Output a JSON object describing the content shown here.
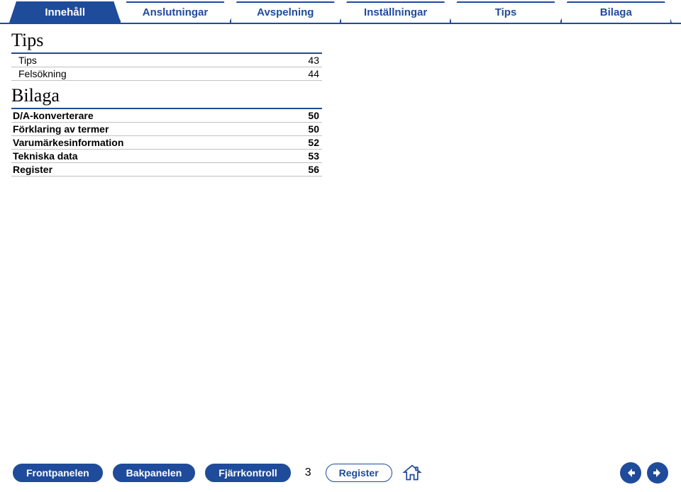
{
  "tabs": {
    "t0": "Innehåll",
    "t1": "Anslutningar",
    "t2": "Avspelning",
    "t3": "Inställningar",
    "t4": "Tips",
    "t5": "Bilaga"
  },
  "sections": {
    "tips": {
      "title": "Tips",
      "rows": [
        {
          "label": "Tips",
          "page": "43"
        },
        {
          "label": "Felsökning",
          "page": "44"
        }
      ]
    },
    "bilaga": {
      "title": "Bilaga",
      "rows": [
        {
          "label": "D/A-konverterare",
          "page": "50"
        },
        {
          "label": "Förklaring av termer",
          "page": "50"
        },
        {
          "label": "Varumärkesinformation",
          "page": "52"
        },
        {
          "label": "Tekniska data",
          "page": "53"
        },
        {
          "label": "Register",
          "page": "56"
        }
      ]
    }
  },
  "footer": {
    "b0": "Frontpanelen",
    "b1": "Bakpanelen",
    "b2": "Fjärrkontroll",
    "page": "3",
    "b3": "Register"
  }
}
